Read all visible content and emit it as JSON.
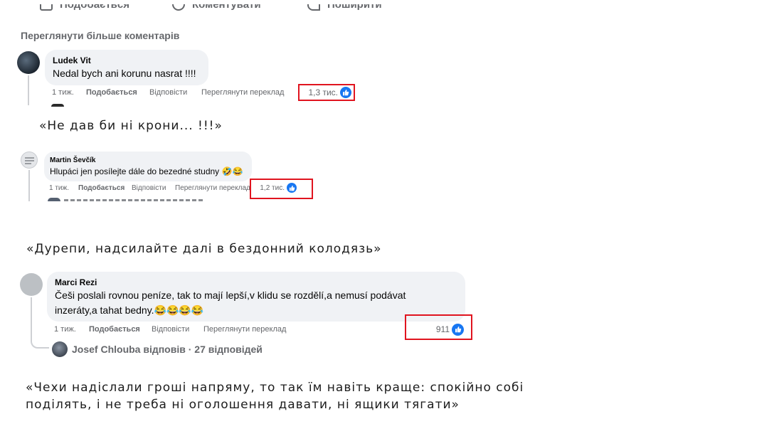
{
  "top_actions": {
    "like": "Подобається",
    "comment": "Коментувати",
    "share": "Поширити"
  },
  "more_comments_link": "Переглянути більше коментарів",
  "comments": [
    {
      "author": "Ludek Vit",
      "text": "Nedal bych ani korunu nasrat !!!!",
      "time": "1 тиж.",
      "like_label": "Подобається",
      "reply_label": "Відповісти",
      "translate_label": "Переглянути переклад",
      "reactions": "1,3 тис.",
      "translation_quote": "«Не дав би ні крони... !!!»"
    },
    {
      "author": "Martin Ševčík",
      "text": "Hlupáci jen posílejte dále do bezedné studny 🤣😂",
      "time": "1 тиж.",
      "like_label": "Подобається",
      "reply_label": "Відповісти",
      "translate_label": "Переглянути переклад",
      "reactions": "1,2 тис.",
      "translation_quote": "«Дурепи, надсилайте далі в бездонний колодязь»"
    },
    {
      "author": "Marci Rezi",
      "text_line1": "Češi poslali rovnou peníze, tak to mají lepší,v klidu se rozdělí,a nemusí podávat",
      "text_line2": "inzeráty,a tahat bedny.😂😂😂😂",
      "time": "1 тиж.",
      "like_label": "Подобається",
      "reply_label": "Відповісти",
      "translate_label": "Переглянути переклад",
      "reactions": "911",
      "replies_summary": "Josef Chlouba відповів · 27 відповідей",
      "translation_quote_line1": "«Чехи надіслали гроші напряму, то так їм навіть краще: спокійно собі",
      "translation_quote_line2": "поділять, і не треба ні оголошення давати, ні ящики тягати»"
    }
  ],
  "colors": {
    "bubble": "#f0f2f5",
    "meta_text": "#65676b",
    "like_blue": "#1877f2",
    "highlight_red": "#e0141f"
  },
  "icons": [
    "like-icon",
    "comment-icon",
    "share-icon",
    "thumbs-up-icon"
  ]
}
